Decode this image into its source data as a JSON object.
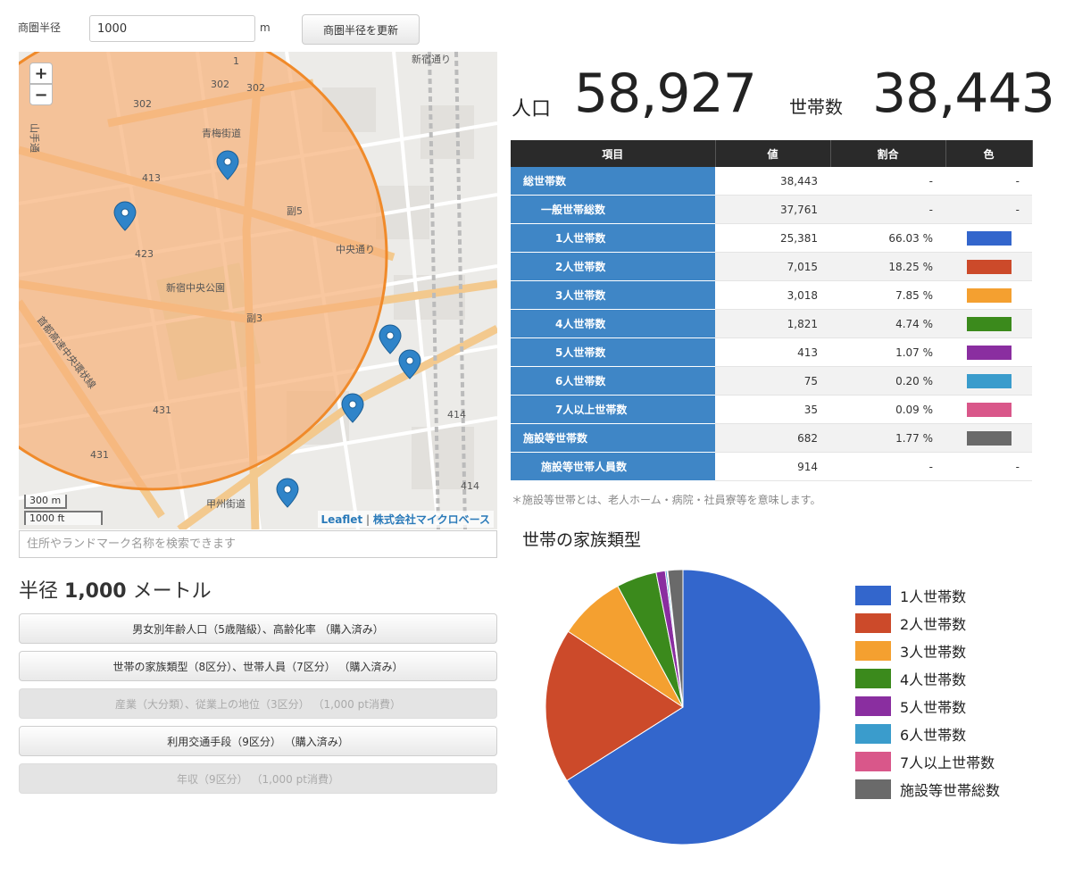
{
  "controls": {
    "radius_label": "商圏半径",
    "radius_value": "1000",
    "radius_unit": "m",
    "update_button": "商圏半径を更新"
  },
  "map": {
    "zoom_in": "+",
    "zoom_out": "−",
    "scale_m": "300 m",
    "scale_ft": "1000 ft",
    "attribution_leaflet": "Leaflet",
    "attribution_sep": " | ",
    "attribution_provider": "株式会社マイクロベース",
    "labels": {
      "r302a": "302",
      "r302b": "302",
      "r302c": "302",
      "r413": "413",
      "r423": "423",
      "r431a": "431",
      "r431b": "431",
      "r414a": "414",
      "r414b": "414",
      "r1": "1",
      "aoume": "青梅街道",
      "chuo": "中央通り",
      "koshu": "甲州街道",
      "shinjukudori": "新宿通り",
      "expressway": "首都高速中央環状線",
      "park": "新宿中央公園",
      "yamate": "山手通",
      "kan5": "副5",
      "kan3": "副3"
    }
  },
  "search": {
    "placeholder": "住所やランドマーク名称を検索できます"
  },
  "radius_heading": {
    "prefix": "半径",
    "value": "1,000",
    "suffix": "メートル"
  },
  "report_buttons": [
    {
      "label": "男女別年齢人口（5歳階級）、高齢化率 （購入済み）",
      "enabled": true
    },
    {
      "label": "世帯の家族類型（8区分）、世帯人員（7区分） （購入済み）",
      "enabled": true
    },
    {
      "label": "産業（大分類）、従業上の地位（3区分） （1,000 pt消費）",
      "enabled": false
    },
    {
      "label": "利用交通手段（9区分） （購入済み）",
      "enabled": true
    },
    {
      "label": "年収（9区分） （1,000 pt消費）",
      "enabled": false
    }
  ],
  "stats": {
    "population_label": "人口",
    "population_value": "58,927",
    "households_label": "世帯数",
    "households_value": "38,443"
  },
  "table": {
    "headers": [
      "項目",
      "値",
      "割合",
      "色"
    ],
    "rows": [
      {
        "name": "総世帯数",
        "value": "38,443",
        "pct": "-",
        "color": "-",
        "indent": 0
      },
      {
        "name": "一般世帯総数",
        "value": "37,761",
        "pct": "-",
        "color": "-",
        "indent": 1
      },
      {
        "name": "1人世帯数",
        "value": "25,381",
        "pct": "66.03 %",
        "color": "#3366cc",
        "indent": 2
      },
      {
        "name": "2人世帯数",
        "value": "7,015",
        "pct": "18.25 %",
        "color": "#cc4a2a",
        "indent": 2
      },
      {
        "name": "3人世帯数",
        "value": "3,018",
        "pct": "7.85 %",
        "color": "#f4a030",
        "indent": 2
      },
      {
        "name": "4人世帯数",
        "value": "1,821",
        "pct": "4.74 %",
        "color": "#3b8a1c",
        "indent": 2
      },
      {
        "name": "5人世帯数",
        "value": "413",
        "pct": "1.07 %",
        "color": "#8a2ea0",
        "indent": 2
      },
      {
        "name": "6人世帯数",
        "value": "75",
        "pct": "0.20 %",
        "color": "#3a9ccc",
        "indent": 2
      },
      {
        "name": "7人以上世帯数",
        "value": "35",
        "pct": "0.09 %",
        "color": "#d9578a",
        "indent": 2
      },
      {
        "name": "施設等世帯数",
        "value": "682",
        "pct": "1.77 %",
        "color": "#6a6a6a",
        "indent": 0
      },
      {
        "name": "施設等世帯人員数",
        "value": "914",
        "pct": "-",
        "color": "-",
        "indent": 1
      }
    ],
    "note": "＊施設等世帯とは、老人ホーム・病院・社員寮等を意味します。"
  },
  "chart_data": {
    "type": "pie",
    "title": "世帯の家族類型",
    "labels": [
      "1人世帯数",
      "2人世帯数",
      "3人世帯数",
      "4人世帯数",
      "5人世帯数",
      "6人世帯数",
      "7人以上世帯数",
      "施設等世帯総数"
    ],
    "values": [
      25381,
      7015,
      3018,
      1821,
      413,
      75,
      35,
      682
    ],
    "colors": [
      "#3366cc",
      "#cc4a2a",
      "#f4a030",
      "#3b8a1c",
      "#8a2ea0",
      "#3a9ccc",
      "#d9578a",
      "#6a6a6a"
    ],
    "legend": "right"
  }
}
